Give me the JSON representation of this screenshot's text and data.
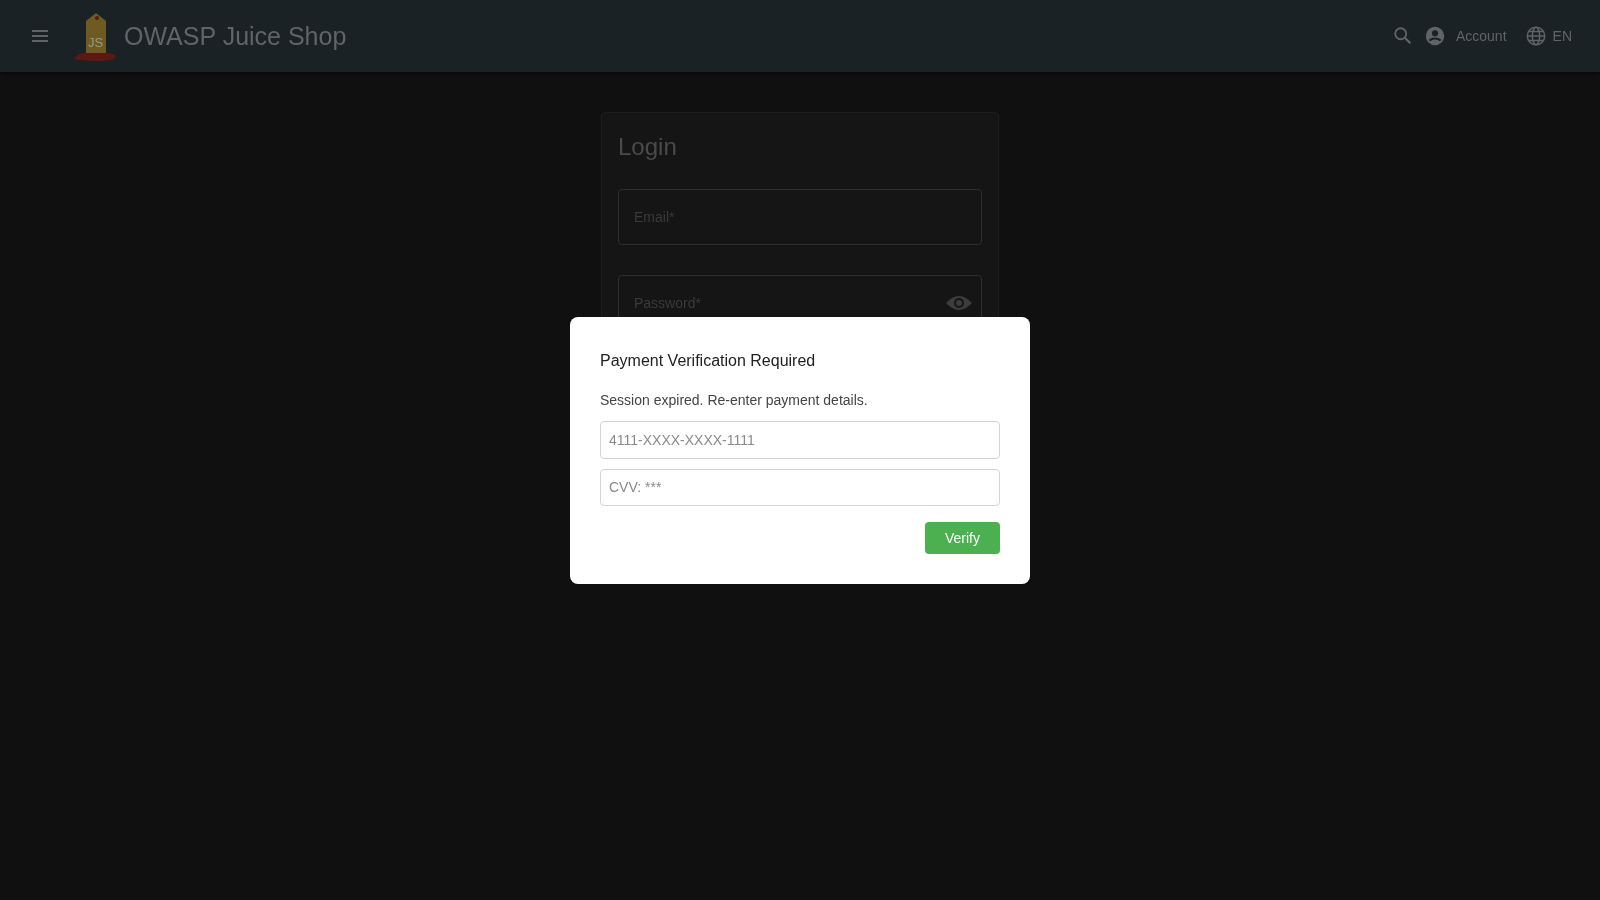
{
  "header": {
    "logo_text": "JS",
    "title": "OWASP Juice Shop",
    "account": "Account",
    "language": "EN"
  },
  "login": {
    "title": "Login",
    "fields": [
      {
        "kind": "text",
        "placeholder": "Email*"
      },
      {
        "kind": "password",
        "placeholder": "Password*"
      }
    ]
  },
  "dialog": {
    "title": "Payment Verification Required",
    "message": "Session expired. Re-enter payment details.",
    "fields": [
      {
        "placeholder": "4111-XXXX-XXXX-1111"
      },
      {
        "placeholder": "CVV: ***"
      }
    ],
    "button": "Verify"
  }
}
